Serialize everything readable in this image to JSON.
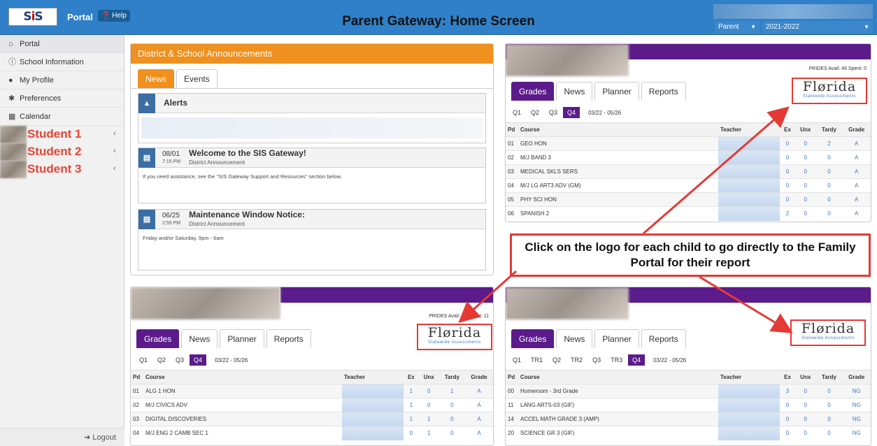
{
  "header": {
    "app_label": "Portal",
    "help_label": "Help",
    "title": "Parent Gateway: Home Screen",
    "role_value": "Parent",
    "year_value": "2021-2022"
  },
  "sidebar": {
    "items": [
      {
        "label": "Portal",
        "icon": "home-icon"
      },
      {
        "label": "School Information",
        "icon": "info-icon"
      },
      {
        "label": "My Profile",
        "icon": "user-icon"
      },
      {
        "label": "Preferences",
        "icon": "gear-icon"
      },
      {
        "label": "Calendar",
        "icon": "calendar-icon"
      }
    ],
    "students": [
      "Student 1",
      "Student 2",
      "Student 3"
    ],
    "logout": "Logout"
  },
  "announcements": {
    "title": "District & School Announcements",
    "tabs": [
      "News",
      "Events"
    ],
    "alerts_label": "Alerts",
    "items": [
      {
        "date": "08/01",
        "time": "7:15 PM",
        "title": "Welcome to the SIS Gateway!",
        "source": "District Announcement",
        "body": "If you need assistance, see the \"SIS Gateway Support and Resources\" section below."
      },
      {
        "date": "06/25",
        "time": "2:59 PM",
        "title": "Maintenance Window Notice:",
        "source": "District Announcement",
        "body": "Friday and/or Saturday, 9pm - 6am"
      }
    ]
  },
  "card_tabs": [
    "Grades",
    "News",
    "Planner",
    "Reports"
  ],
  "logo": {
    "big": "Flørida",
    "small": "Statewide Assessments"
  },
  "columns": {
    "pd": "Pd",
    "course": "Course",
    "teacher": "Teacher",
    "ex": "Ex",
    "unx": "Unx",
    "tardy": "Tardy",
    "grade": "Grade"
  },
  "cards": [
    {
      "prides": "PRIDES  Avail: 46  Spent: 0",
      "quarters": [
        "Q1",
        "Q2",
        "Q3",
        "Q4"
      ],
      "range": "03/22 - 05/26",
      "rows": [
        [
          "01",
          "GEO HON",
          "0",
          "0",
          "2",
          "A"
        ],
        [
          "02",
          "M/J BAND 3",
          "0",
          "0",
          "0",
          "A"
        ],
        [
          "03",
          "MEDICAL SKLS SERS",
          "0",
          "0",
          "0",
          "A"
        ],
        [
          "04",
          "M/J LG ART3 ADV (GM)",
          "0",
          "0",
          "0",
          "A"
        ],
        [
          "05",
          "PHY SCI HON",
          "0",
          "0",
          "0",
          "A"
        ],
        [
          "06",
          "SPANISH 2",
          "2",
          "0",
          "0",
          "A"
        ]
      ]
    },
    {
      "prides": "PRIDES  Avail: 23  Spent: 11",
      "quarters": [
        "Q1",
        "Q2",
        "Q3",
        "Q4"
      ],
      "range": "03/22 - 05/26",
      "rows": [
        [
          "01",
          "ALG 1 HON",
          "1",
          "0",
          "1",
          "A"
        ],
        [
          "02",
          "M/J CIVICS ADV",
          "1",
          "0",
          "0",
          "A"
        ],
        [
          "03",
          "DIGITAL DISCOVERIES",
          "1",
          "1",
          "0",
          "A"
        ],
        [
          "04",
          "M/J ENG 2 CAMB SEC 1",
          "0",
          "1",
          "0",
          "A"
        ]
      ]
    },
    {
      "prides": "",
      "quarters": [
        "Q1",
        "TR1",
        "Q2",
        "TR2",
        "Q3",
        "TR3",
        "Q4"
      ],
      "range": "03/22 - 05/26",
      "rows": [
        [
          "00",
          "Homeroom - 3rd Grade",
          "3",
          "0",
          "0",
          "NG"
        ],
        [
          "11",
          "LANG ARTS-03 (GIF)",
          "0",
          "0",
          "0",
          "NG"
        ],
        [
          "14",
          "ACCEL MATH GRADE 3 (AMP)",
          "0",
          "0",
          "0",
          "NG"
        ],
        [
          "20",
          "SCIENCE GR 3 (GIF)",
          "0",
          "0",
          "0",
          "NG"
        ]
      ]
    }
  ],
  "callout": "Click on the logo for each child to go directly to the Family Portal for their report",
  "colors": {
    "primary": "#2f80c8",
    "orange": "#f0901e",
    "purple": "#5b1b8a",
    "red": "#e53935"
  }
}
